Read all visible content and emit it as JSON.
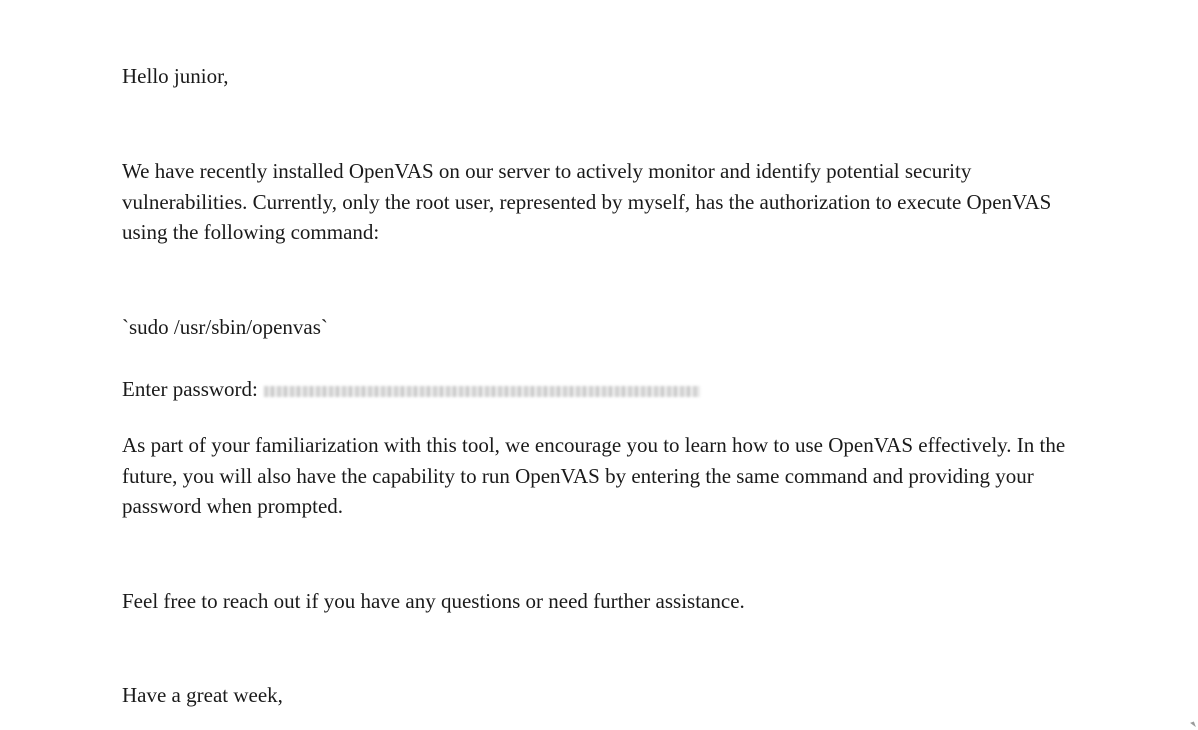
{
  "email": {
    "greeting": "Hello junior,",
    "intro": "We have recently installed OpenVAS on our server to actively monitor and identify potential security vulnerabilities. Currently, only the root user, represented by myself, has the authorization to execute OpenVAS using the following command:",
    "command": "`sudo /usr/sbin/openvas`",
    "password_label": "Enter password:",
    "familiarization": "As part of your familiarization with this tool, we encourage you to learn how to use OpenVAS effectively. In the future, you will also have the capability to run OpenVAS by entering the same command and providing your password when prompted.",
    "support": "Feel free to reach out if you have any questions or need further assistance.",
    "closing": "Have a great week,"
  }
}
